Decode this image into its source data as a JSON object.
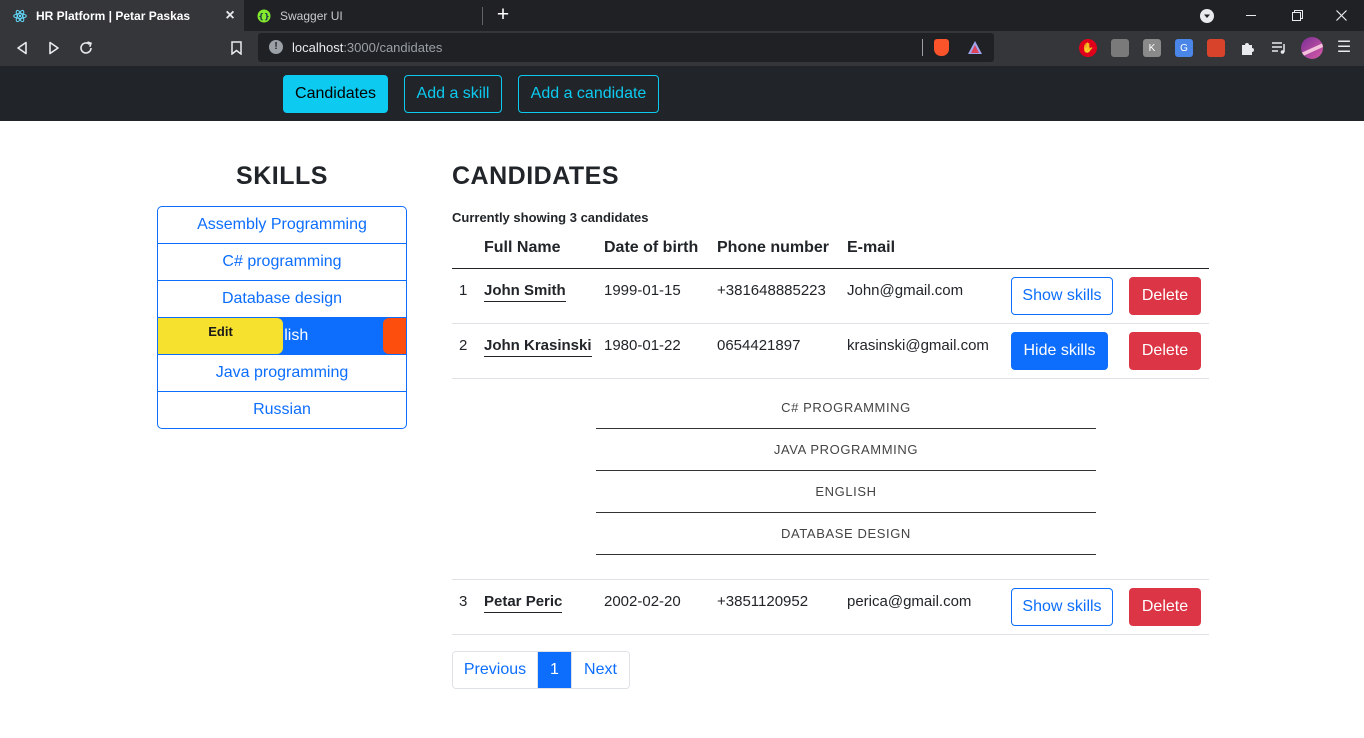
{
  "browser": {
    "tabs": [
      {
        "title": "HR Platform | Petar Paskas",
        "icon": "react-icon",
        "active": true
      },
      {
        "title": "Swagger UI",
        "icon": "swagger-icon",
        "active": false
      }
    ],
    "url_host": "localhost",
    "url_path": ":3000/candidates"
  },
  "nav": {
    "links": [
      "Candidates",
      "Add a skill",
      "Add a candidate"
    ],
    "active_index": 0
  },
  "skills": {
    "title": "SKILLS",
    "items": [
      "Assembly Programming",
      "C# programming",
      "Database design",
      "English",
      "Java programming",
      "Russian"
    ],
    "active_index": 3,
    "active_visible_text": "lish",
    "edit_label": "Edit"
  },
  "candidates": {
    "title": "CANDIDATES",
    "count_text": "Currently showing 3 candidates",
    "columns": [
      "Full Name",
      "Date of birth",
      "Phone number",
      "E-mail"
    ],
    "rows": [
      {
        "index": "1",
        "name": "John Smith",
        "dob": "1999-01-15",
        "phone": "+381648885223",
        "email": "John@gmail.com",
        "skills_button": "Show skills",
        "delete_button": "Delete"
      },
      {
        "index": "2",
        "name": "John Krasinski",
        "dob": "1980-01-22",
        "phone": "0654421897",
        "email": "krasinski@gmail.com",
        "skills_button": "Hide skills",
        "delete_button": "Delete"
      },
      {
        "index": "3",
        "name": "Petar Peric",
        "dob": "2002-02-20",
        "phone": "+3851120952",
        "email": "perica@gmail.com",
        "skills_button": "Show skills",
        "delete_button": "Delete"
      }
    ],
    "expanded_skills": [
      "C# PROGRAMMING",
      "JAVA PROGRAMMING",
      "ENGLISH",
      "DATABASE DESIGN"
    ]
  },
  "pagination": {
    "previous": "Previous",
    "current": "1",
    "next": "Next"
  },
  "colors": {
    "primary": "#0d6efd",
    "info": "#0dcaf0",
    "danger": "#dc3545",
    "warning": "#f5e12e",
    "navbar": "#212529"
  }
}
